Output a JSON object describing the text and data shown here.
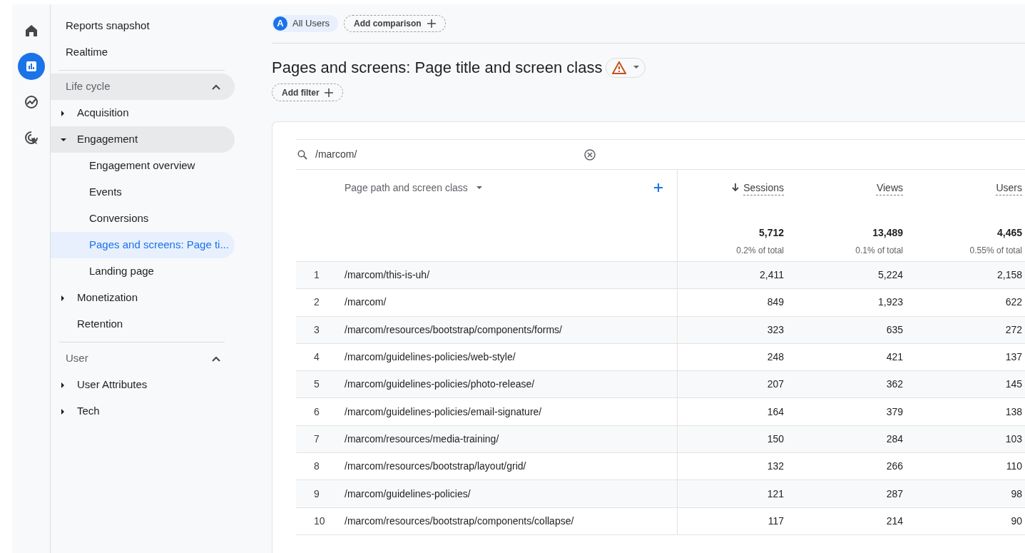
{
  "nav_rail": [
    {
      "kind": "home",
      "selected": false
    },
    {
      "kind": "reports",
      "selected": true
    },
    {
      "kind": "explore",
      "selected": false
    },
    {
      "kind": "advertising",
      "selected": false
    }
  ],
  "sidebar": {
    "top_items": [
      {
        "label": "Reports snapshot",
        "selected": false
      },
      {
        "label": "Realtime",
        "selected": false
      }
    ],
    "sections": [
      {
        "title": "Life cycle",
        "expanded": true,
        "highlighted": true,
        "items": [
          {
            "label": "Acquisition",
            "kind": "group",
            "expanded": false
          },
          {
            "label": "Engagement",
            "kind": "group",
            "expanded": true,
            "children": [
              {
                "label": "Engagement overview",
                "selected": false
              },
              {
                "label": "Events",
                "selected": false
              },
              {
                "label": "Conversions",
                "selected": false
              },
              {
                "label": "Pages and screens: Page ti...",
                "selected": true
              },
              {
                "label": "Landing page",
                "selected": false
              }
            ]
          },
          {
            "label": "Monetization",
            "kind": "group",
            "expanded": false
          },
          {
            "label": "Retention",
            "kind": "link",
            "expanded": false
          }
        ]
      },
      {
        "title": "User",
        "expanded": true,
        "highlighted": false,
        "items": [
          {
            "label": "User Attributes",
            "kind": "group",
            "expanded": false
          },
          {
            "label": "Tech",
            "kind": "group",
            "expanded": false
          }
        ]
      }
    ]
  },
  "comparison_bar": {
    "segment_badge": "A",
    "segment": "All Users",
    "add_button": "Add comparison"
  },
  "report": {
    "title": "Pages and screens: Page title and screen class",
    "add_filter": "Add filter"
  },
  "table": {
    "search": {
      "value": "/marcom/"
    },
    "dimension": "Page path and screen class",
    "columns": [
      {
        "label": "Sessions",
        "sorted": true
      },
      {
        "label": "Views",
        "sorted": false
      },
      {
        "label": "Users",
        "sorted": false
      }
    ],
    "totals": [
      {
        "value": "5,712",
        "share": "0.2% of total"
      },
      {
        "value": "13,489",
        "share": "0.1% of total"
      },
      {
        "value": "4,465",
        "share": "0.55% of total"
      }
    ],
    "rows": [
      {
        "index": "1",
        "path": "/marcom/this-is-uh/",
        "values": [
          "2,411",
          "5,224",
          "2,158"
        ]
      },
      {
        "index": "2",
        "path": "/marcom/",
        "values": [
          "849",
          "1,923",
          "622"
        ]
      },
      {
        "index": "3",
        "path": "/marcom/resources/bootstrap/components/forms/",
        "values": [
          "323",
          "635",
          "272"
        ]
      },
      {
        "index": "4",
        "path": "/marcom/guidelines-policies/web-style/",
        "values": [
          "248",
          "421",
          "137"
        ]
      },
      {
        "index": "5",
        "path": "/marcom/guidelines-policies/photo-release/",
        "values": [
          "207",
          "362",
          "145"
        ]
      },
      {
        "index": "6",
        "path": "/marcom/guidelines-policies/email-signature/",
        "values": [
          "164",
          "379",
          "138"
        ]
      },
      {
        "index": "7",
        "path": "/marcom/resources/media-training/",
        "values": [
          "150",
          "284",
          "103"
        ]
      },
      {
        "index": "8",
        "path": "/marcom/resources/bootstrap/layout/grid/",
        "values": [
          "132",
          "266",
          "110"
        ]
      },
      {
        "index": "9",
        "path": "/marcom/guidelines-policies/",
        "values": [
          "121",
          "287",
          "98"
        ]
      },
      {
        "index": "10",
        "path": "/marcom/resources/bootstrap/components/collapse/",
        "values": [
          "117",
          "214",
          "90"
        ]
      }
    ]
  }
}
